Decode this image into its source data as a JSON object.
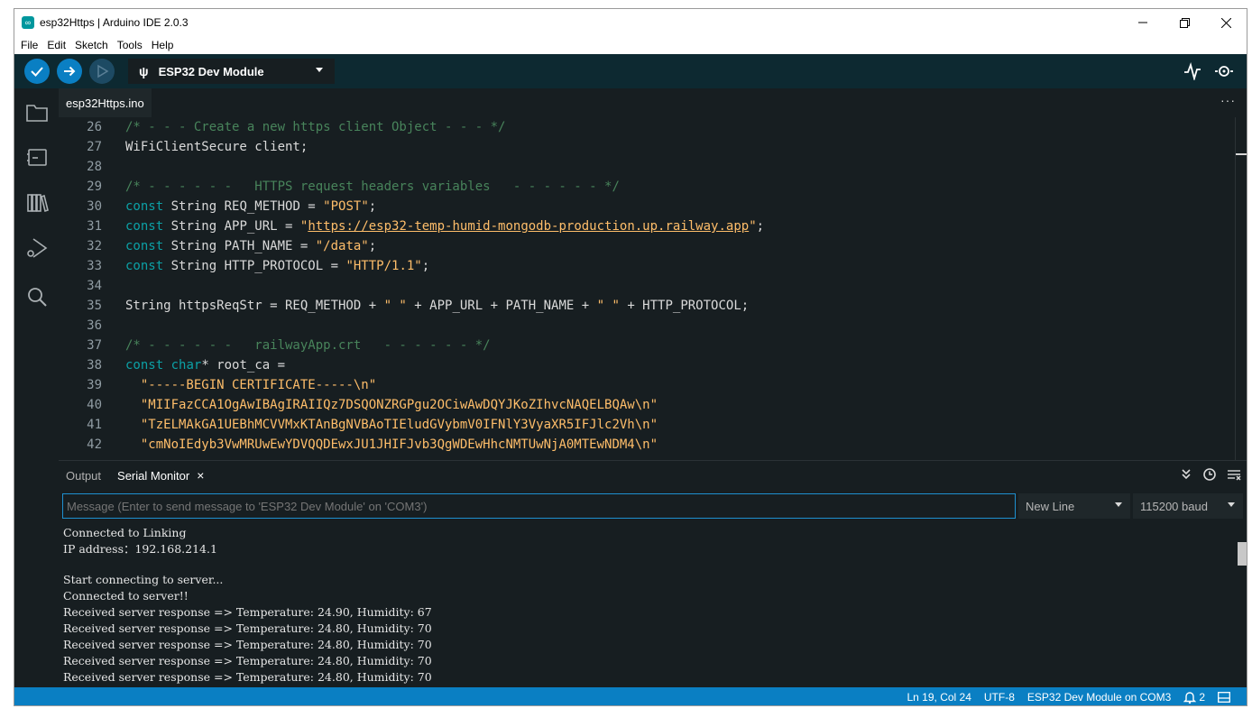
{
  "window": {
    "title": "esp32Https | Arduino IDE 2.0.3",
    "app_icon": "∞"
  },
  "menu": [
    "File",
    "Edit",
    "Sketch",
    "Tools",
    "Help"
  ],
  "toolbar": {
    "board": "ESP32 Dev Module"
  },
  "editor": {
    "tab": "esp32Https.ino",
    "lines": [
      {
        "n": "26"
      },
      {
        "n": "27"
      },
      {
        "n": "28"
      },
      {
        "n": "29"
      },
      {
        "n": "30"
      },
      {
        "n": "31"
      },
      {
        "n": "32"
      },
      {
        "n": "33"
      },
      {
        "n": "34"
      },
      {
        "n": "35"
      },
      {
        "n": "36"
      },
      {
        "n": "37"
      },
      {
        "n": "38"
      },
      {
        "n": "39"
      },
      {
        "n": "40"
      },
      {
        "n": "41"
      },
      {
        "n": "42"
      }
    ],
    "code": {
      "l26": "/* - - - Create a new https client Object - - - */",
      "l27": "WiFiClientSecure client;",
      "l29": "/* - - - - - -   HTTPS request headers variables   - - - - - - */",
      "kw_const": "const",
      "l30_mid": " String REQ_METHOD = ",
      "l30_str": "\"POST\"",
      "l31_mid": " String APP_URL = ",
      "l31_q1": "\"",
      "l31_url": "https://esp32-temp-humid-mongodb-production.up.railway.app",
      "l31_q2": "\"",
      "l32_mid": " String PATH_NAME = ",
      "l32_str": "\"/data\"",
      "l33_mid": " String HTTP_PROTOCOL = ",
      "l33_str": "\"HTTP/1.1\"",
      "semi": ";",
      "l35_a": "String httpsReqStr = REQ_METHOD + ",
      "l35_s1": "\" \"",
      "l35_b": " + APP_URL + PATH_NAME + ",
      "l35_s2": "\" \"",
      "l35_c": " + HTTP_PROTOCOL;",
      "l37": "/* - - - - - -   railwayApp.crt   - - - - - - */",
      "kw_char": "char",
      "l38_rest": "* root_ca =",
      "l39": "\"-----BEGIN CERTIFICATE-----\\n\"",
      "l40": "\"MIIFazCCA1OgAwIBAgIRAIIQz7DSQONZRGPgu2OCiwAwDQYJKoZIhvcNAQELBQAw\\n\"",
      "l41": "\"TzELMAkGA1UEBhMCVVMxKTAnBgNVBAoTIEludGVybmV0IFNlY3VyaXR5IFJlc2Vh\\n\"",
      "l42": "\"cmNoIEdyb3VwMRUwEwYDVQQDEwxJU1JHIFJvb3QgWDEwHhcNMTUwNjA0MTEwNDM4\\n\""
    }
  },
  "panel": {
    "tabs": {
      "output": "Output",
      "serial": "Serial Monitor"
    },
    "message_placeholder": "Message (Enter to send message to 'ESP32 Dev Module' on 'COM3')",
    "line_ending": "New Line",
    "baud": "115200 baud",
    "serial_lines": [
      "Connected to Linking",
      "IP address：192.168.214.1",
      "",
      "Start connecting to server...",
      "Connected to server!!",
      "Received server response => Temperature: 24.90, Humidity: 67",
      "Received server response => Temperature: 24.80, Humidity: 70",
      "Received server response => Temperature: 24.80, Humidity: 70",
      "Received server response => Temperature: 24.80, Humidity: 70",
      "Received server response => Temperature: 24.80, Humidity: 70"
    ]
  },
  "status": {
    "position": "Ln 19, Col 24",
    "encoding": "UTF-8",
    "board": "ESP32 Dev Module on COM3",
    "notifications": "2"
  },
  "colors": {
    "accent": "#0a7fc3",
    "toolbar": "#0d2931",
    "editor_bg": "#171e21",
    "comment": "#48845b",
    "keyword": "#0ca1a6",
    "string": "#ffbe6a"
  }
}
